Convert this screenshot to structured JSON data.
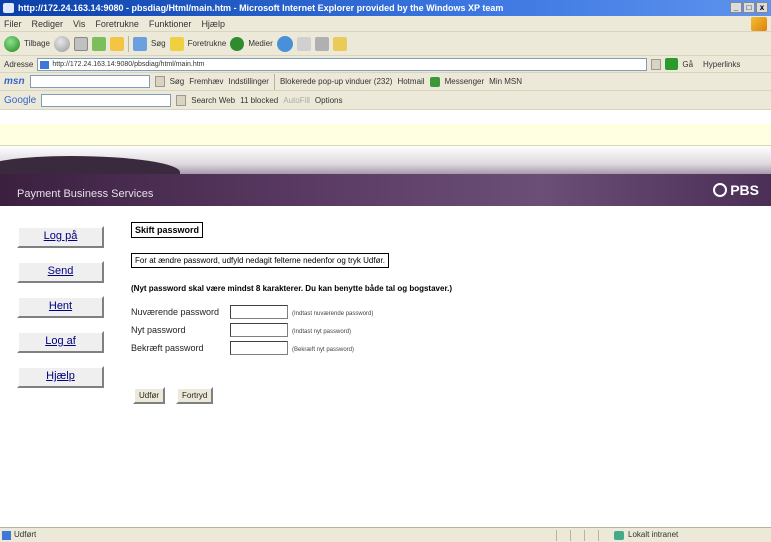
{
  "window": {
    "title": "http://172.24.163.14:9080 - pbsdiag/Html/main.htm - Microsoft Internet Explorer provided by the Windows XP team"
  },
  "menu": [
    "Filer",
    "Rediger",
    "Vis",
    "Foretrukne",
    "Funktioner",
    "Hjælp"
  ],
  "toolbar": {
    "back": "Tilbage",
    "search": "Søg",
    "favorites": "Foretrukne",
    "media": "Medier"
  },
  "address": {
    "label": "Adresse",
    "value": "http://172.24.163.14:9080/pbsdiag/html/main.htm",
    "go": "Gå",
    "links": "Hyperlinks"
  },
  "msnbar": {
    "logo": "msn",
    "search": "Søg",
    "highlight": "Fremhæv",
    "settings": "Indstillinger",
    "popup": "Blokerede pop-up vinduer (232)",
    "hotmail": "Hotmail",
    "messenger": "Messenger",
    "mymsn": "Min MSN"
  },
  "googlebar": {
    "logo": "Google",
    "search_web": "Search Web",
    "blocked": "11 blocked",
    "autofill": "AutoFill",
    "options": "Options"
  },
  "banner": {
    "brand": "Payment Business Services",
    "logo": "PBS"
  },
  "nav": [
    "Log på",
    "Send",
    "Hent",
    "Log af",
    "Hjælp"
  ],
  "form": {
    "title": "Skift password",
    "instruction": "For at ændre password, udfyld nedagit felterne nedenfor og tryk Udfør.",
    "rule": "(Nyt password skal være mindst 8 karakterer. Du kan benytte både tal og bogstaver.)",
    "fields": [
      {
        "label": "Nuværende password",
        "hint": "(Indtast nuværende password)"
      },
      {
        "label": "Nyt password",
        "hint": "(Indtast nyt password)"
      },
      {
        "label": "Bekræft password",
        "hint": "(Bekræft nyt password)"
      }
    ],
    "submit": "Udfør",
    "reset": "Fortryd"
  },
  "status": {
    "left": "Udført",
    "zone": "Lokalt intranet"
  },
  "colors": {
    "link": "#000080",
    "infobar": "#ffffe1",
    "chrome": "#ece9d8"
  }
}
